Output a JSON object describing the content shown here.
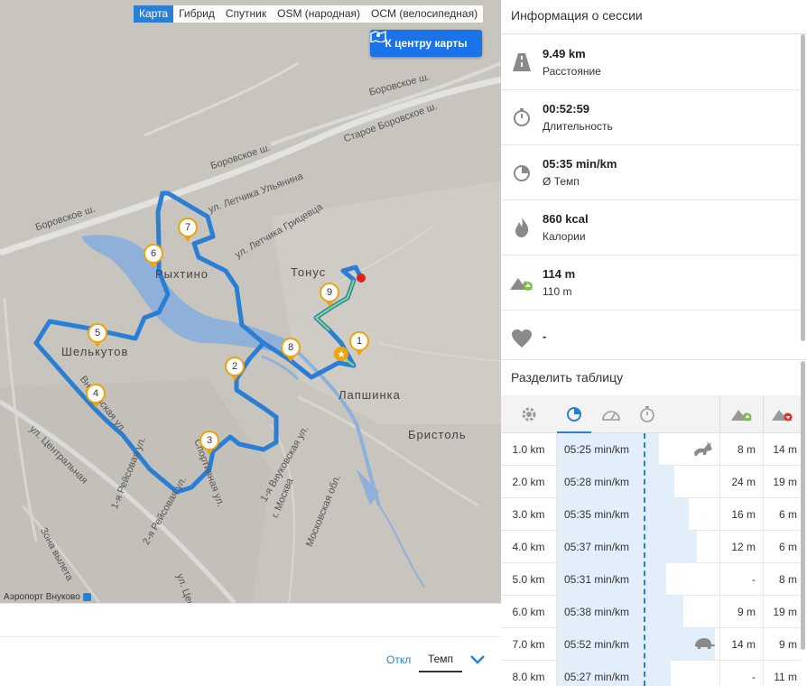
{
  "map": {
    "tabs": [
      {
        "label": "Карта",
        "active": true
      },
      {
        "label": "Гибрид",
        "active": false
      },
      {
        "label": "Спутник",
        "active": false
      },
      {
        "label": "OSM (народная)",
        "active": false
      },
      {
        "label": "OCM (велосипедная)",
        "active": false
      }
    ],
    "center_button": "К центру карты",
    "markers": [
      "1",
      "2",
      "3",
      "4",
      "5",
      "6",
      "7",
      "8",
      "9"
    ],
    "labels": {
      "borovskoe1": "Боровское ш.",
      "borovskoe2": "Боровское ш.",
      "borovskoe3": "Боровское ш.",
      "staroe": "Старое Боровское ш.",
      "uljanina": "ул. Летчика Ульянина",
      "gricevca": "ул. Летчика Грицевца",
      "tonus": "Тонус",
      "ryhtino": "Рыхтино",
      "shelkutov": "Шелькутов",
      "lapshinka": "Лапшинка",
      "bristol": "Бристоль",
      "vnukovskaya": "Внуковская ул.",
      "vnukovskaya1": "1-я Внуковская ул.",
      "centralnaya": "ул. Центральная",
      "reis1": "1-я Рейсовая ул.",
      "reis2": "2-я Рейсовая ул.",
      "sportivnaya": "Спортивная ул.",
      "moskva": "г. Москва",
      "mo": "Московская обл.",
      "zona": "Зона вылета",
      "ultsen": "ул. Цен",
      "airport": "Аэропорт Внуково"
    },
    "colors": {
      "route": "#2a7fd4",
      "marker": "#f0a30a",
      "green_segment": "#8be04e",
      "end_point": "#e02020"
    }
  },
  "bottom_bar": {
    "off_label": "Откл",
    "temp_label": "Темп",
    "chevron_icon": "chevron-down-icon"
  },
  "session": {
    "title": "Информация о сессии",
    "stats": [
      {
        "icon": "road-icon",
        "value": "9.49 km",
        "label": "Расстояние"
      },
      {
        "icon": "stopwatch-icon",
        "value": "00:52:59",
        "label": "Длительность"
      },
      {
        "icon": "pace-icon",
        "value": "05:35 min/km",
        "label": "Ø Темп"
      },
      {
        "icon": "flame-icon",
        "value": "860 kcal",
        "label": "Калории"
      },
      {
        "icon": "elevation-up-icon",
        "value": "114 m",
        "label": "110 m"
      },
      {
        "icon": "heart-icon",
        "value": "-",
        "label": ""
      }
    ]
  },
  "split_table": {
    "title": "Разделить таблицу",
    "header_icons": [
      "settings-icon",
      "pace-icon",
      "speedometer-icon",
      "stopwatch-icon",
      "elevation-gain-icon",
      "elevation-loss-icon"
    ],
    "pace_fractions": [
      0.63,
      0.72,
      0.81,
      0.86,
      0.67,
      0.78,
      0.97,
      0.7
    ],
    "rows": [
      {
        "km": "1.0 km",
        "pace": "05:25 min/km",
        "up": "8 m",
        "down": "14 m",
        "animal": "rabbit-icon"
      },
      {
        "km": "2.0 km",
        "pace": "05:28 min/km",
        "up": "24 m",
        "down": "19 m",
        "animal": ""
      },
      {
        "km": "3.0 km",
        "pace": "05:35 min/km",
        "up": "16 m",
        "down": "6 m",
        "animal": ""
      },
      {
        "km": "4.0 km",
        "pace": "05:37 min/km",
        "up": "12 m",
        "down": "6 m",
        "animal": ""
      },
      {
        "km": "5.0 km",
        "pace": "05:31 min/km",
        "up": "-",
        "down": "8 m",
        "animal": ""
      },
      {
        "km": "6.0 km",
        "pace": "05:38 min/km",
        "up": "9 m",
        "down": "19 m",
        "animal": ""
      },
      {
        "km": "7.0 km",
        "pace": "05:52 min/km",
        "up": "14 m",
        "down": "9 m",
        "animal": "turtle-icon"
      },
      {
        "km": "8.0 km",
        "pace": "05:27 min/km",
        "up": "-",
        "down": "11 m",
        "animal": ""
      }
    ]
  }
}
